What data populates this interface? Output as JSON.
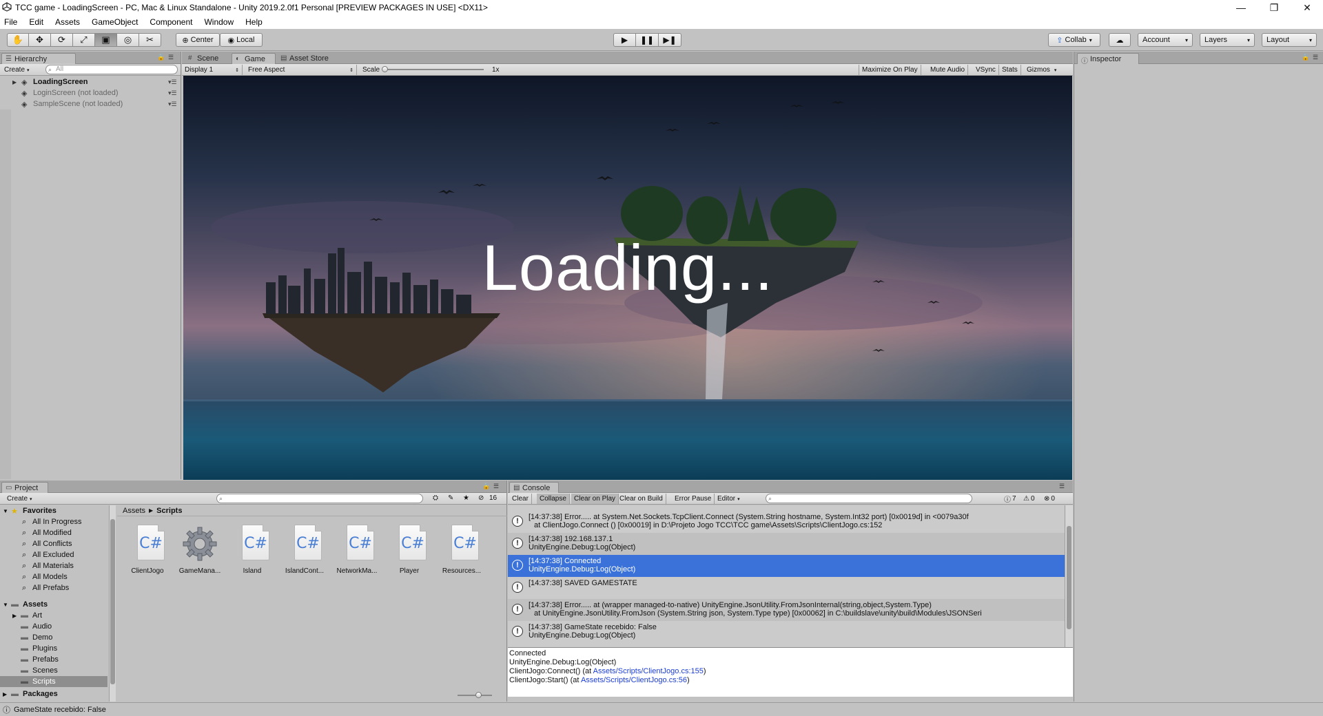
{
  "window": {
    "title": "TCC game - LoadingScreen - PC, Mac & Linux Standalone - Unity 2019.2.0f1 Personal [PREVIEW PACKAGES IN USE] <DX11>",
    "controls": [
      "—",
      "❐",
      "✕"
    ]
  },
  "menu": [
    "File",
    "Edit",
    "Assets",
    "GameObject",
    "Component",
    "Window",
    "Help"
  ],
  "toolbar": {
    "tools": [
      "hand-tool",
      "move-tool",
      "rotate-tool",
      "scale-tool",
      "rect-tool",
      "transform-tool",
      "custom-tool"
    ],
    "center_label": "Center",
    "local_label": "Local",
    "collab_label": "Collab",
    "account_label": "Account",
    "layers_label": "Layers",
    "layout_label": "Layout"
  },
  "hierarchy": {
    "tab": "Hierarchy",
    "create": "Create",
    "search_placeholder": "All",
    "scenes": [
      {
        "name": "LoadingScreen",
        "bold": true
      },
      {
        "name": "LoginScreen (not loaded)",
        "bold": false
      },
      {
        "name": "SampleScene (not loaded)",
        "bold": false
      }
    ]
  },
  "center_tabs": {
    "scene": "Scene",
    "game": "Game",
    "asset_store": "Asset Store"
  },
  "game_toolbar": {
    "display": "Display 1",
    "aspect": "Free Aspect",
    "scale_label": "Scale",
    "scale_value": "1x",
    "maximize": "Maximize On Play",
    "mute": "Mute Audio",
    "vsync": "VSync",
    "stats": "Stats",
    "gizmos": "Gizmos"
  },
  "game_view": {
    "loading_text": "Loading..."
  },
  "inspector": {
    "tab": "Inspector"
  },
  "project": {
    "tab": "Project",
    "create": "Create",
    "hidden_count": "16",
    "breadcrumb_root": "Assets",
    "breadcrumb_current": "Scripts",
    "favorites_label": "Favorites",
    "favorites": [
      "All In Progress",
      "All Modified",
      "All Conflicts",
      "All Excluded",
      "All Materials",
      "All Models",
      "All Prefabs"
    ],
    "assets_label": "Assets",
    "folders": [
      "Art",
      "Audio",
      "Demo",
      "Plugins",
      "Prefabs",
      "Scenes",
      "Scripts"
    ],
    "packages_label": "Packages",
    "files": [
      {
        "name": "ClientJogo",
        "type": "cs"
      },
      {
        "name": "GameMana...",
        "type": "gear"
      },
      {
        "name": "Island",
        "type": "cs"
      },
      {
        "name": "IslandCont...",
        "type": "cs"
      },
      {
        "name": "NetworkMa...",
        "type": "cs"
      },
      {
        "name": "Player",
        "type": "cs"
      },
      {
        "name": "Resources...",
        "type": "cs"
      }
    ]
  },
  "console": {
    "tab": "Console",
    "buttons": [
      "Clear",
      "Collapse",
      "Clear on Play",
      "Clear on Build",
      "Error Pause",
      "Editor"
    ],
    "counts": {
      "log": "7",
      "warn": "0",
      "error": "0"
    },
    "entries": [
      {
        "l1": "[14:37:38] Error.....     at System.Net.Sockets.TcpClient.Connect (System.String hostname, System.Int32 port) [0x0019d] in <0079a30f",
        "l2": "at ClientJogo.Connect () [0x00019] in D:\\Projeto Jogo TCC\\TCC game\\Assets\\Scripts\\ClientJogo.cs:152",
        "indent": true,
        "selected": false
      },
      {
        "l1": "[14:37:38] 192.168.137.1",
        "l2": "UnityEngine.Debug:Log(Object)",
        "indent": false,
        "selected": false
      },
      {
        "l1": "[14:37:38] Connected",
        "l2": "UnityEngine.Debug:Log(Object)",
        "indent": false,
        "selected": true
      },
      {
        "l1": "[14:37:38] SAVED GAMESTATE",
        "l2": "",
        "indent": false,
        "selected": false
      },
      {
        "l1": "[14:37:38] Error.....     at (wrapper managed-to-native) UnityEngine.JsonUtility.FromJsonInternal(string,object,System.Type)",
        "l2": "at UnityEngine.JsonUtility.FromJson (System.String json, System.Type type) [0x00062] in C:\\buildslave\\unity\\build\\Modules\\JSONSeri",
        "indent": true,
        "selected": false
      },
      {
        "l1": "[14:37:38] GameState recebido: False",
        "l2": "UnityEngine.Debug:Log(Object)",
        "indent": false,
        "selected": false
      }
    ],
    "detail": {
      "line1": "Connected",
      "line2": "UnityEngine.Debug:Log(Object)",
      "line3_prefix": "ClientJogo:Connect() (at ",
      "line3_link": "Assets/Scripts/ClientJogo.cs:155",
      "line3_suffix": ")",
      "line4_prefix": "ClientJogo:Start() (at ",
      "line4_link": "Assets/Scripts/ClientJogo.cs:56",
      "line4_suffix": ")"
    }
  },
  "status": {
    "message": "GameState recebido: False"
  },
  "colors": {
    "editor_bg": "#c2c2c2",
    "selection": "#3a72d9",
    "link": "#1a3cd8"
  }
}
